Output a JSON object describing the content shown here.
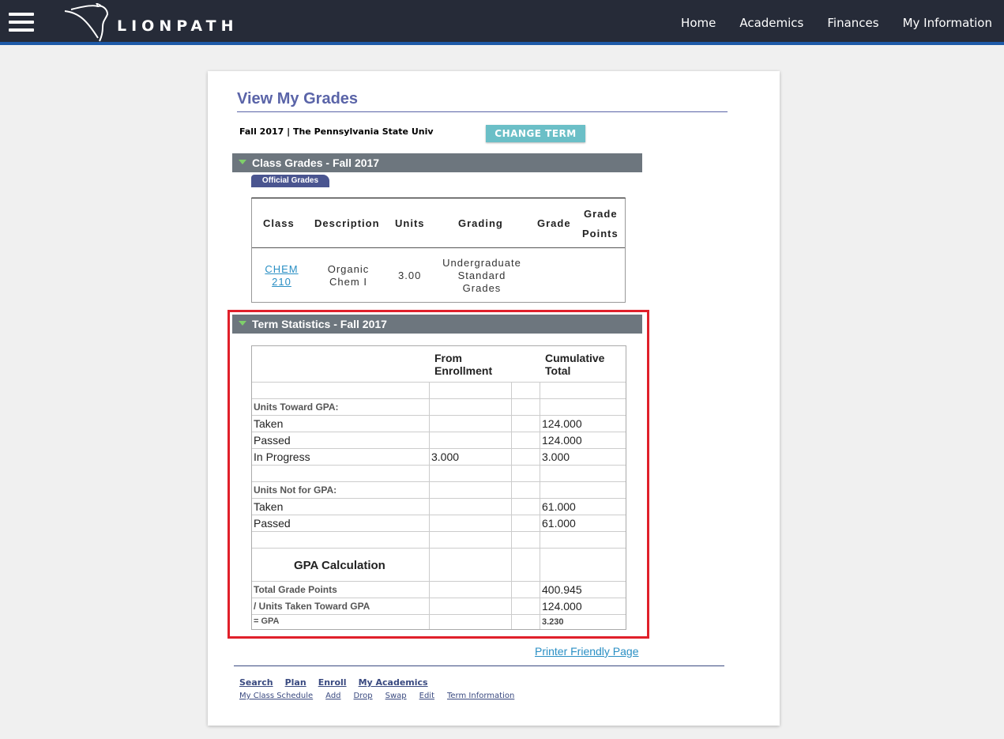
{
  "header": {
    "logo_text": "LIONPATH",
    "nav": [
      "Home",
      "Academics",
      "Finances",
      "My Information"
    ]
  },
  "page": {
    "title": "View My Grades",
    "term_line": "Fall 2017 | The Pennsylvania State Univ",
    "change_term_label": "CHANGE TERM"
  },
  "class_grades": {
    "section_title": "Class Grades - Fall 2017",
    "tab_label": "Official Grades",
    "headers": {
      "class": "Class",
      "description": "Description",
      "units": "Units",
      "grading": "Grading",
      "grade": "Grade",
      "grade_points_1": "Grade",
      "grade_points_2": "Points"
    },
    "row": {
      "class_1": "CHEM",
      "class_2": "210",
      "description_1": "Organic",
      "description_2": "Chem I",
      "units": "3.00",
      "grading_1": "Undergraduate",
      "grading_2": "Standard",
      "grading_3": "Grades",
      "grade": "",
      "grade_points": ""
    }
  },
  "term_statistics": {
    "section_title": "Term Statistics - Fall 2017",
    "col_enrollment_1": "From",
    "col_enrollment_2": "Enrollment",
    "col_cumulative_1": "Cumulative",
    "col_cumulative_2": "Total",
    "units_toward_gpa": "Units Toward GPA:",
    "taken_label": "Taken",
    "taken_cum": "124.000",
    "passed_label": "Passed",
    "passed_cum": "124.000",
    "in_progress_label": "In Progress",
    "in_progress_enroll": "3.000",
    "in_progress_cum": "3.000",
    "units_not_gpa": "Units Not for GPA:",
    "ng_taken_label": "Taken",
    "ng_taken_cum": "61.000",
    "ng_passed_label": "Passed",
    "ng_passed_cum": "61.000",
    "gpa_calc_label": "GPA Calculation",
    "total_gp_label": "Total Grade Points",
    "total_gp_cum": "400.945",
    "units_taken_label": "/  Units Taken Toward GPA",
    "units_taken_cum": "124.000",
    "gpa_label": "= GPA",
    "gpa_cum": "3.230"
  },
  "footer": {
    "printer_label": "Printer Friendly Page",
    "links_primary": [
      "Search",
      "Plan",
      "Enroll",
      "My Academics"
    ],
    "links_secondary": [
      "My Class Schedule",
      "Add",
      "Drop",
      "Swap",
      "Edit",
      "Term Information"
    ]
  }
}
